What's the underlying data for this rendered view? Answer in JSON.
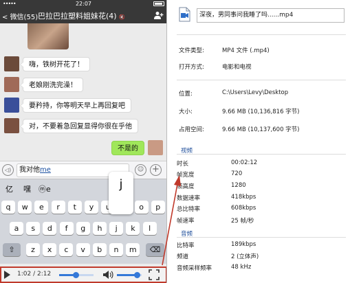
{
  "status_bar": {
    "signal": "•••••",
    "time": "22:07"
  },
  "nav": {
    "back_label": "微信(55)",
    "chat_title": "巴拉巴拉塑料姐妹花(4)",
    "mute_symbol": "🔇"
  },
  "messages": [
    {
      "text": "嗨，铁树开花了！",
      "avatar_color": "#6b4a3a"
    },
    {
      "text": "老娘刚洗完澡！",
      "avatar_color": "#a06a58"
    },
    {
      "text": "要矜持，你等明天早上再回复吧",
      "avatar_color": "#3a4f9a"
    },
    {
      "text": "对，不要着急回复显得你很在乎他",
      "avatar_color": "#7a5040"
    }
  ],
  "my_message": {
    "text": "不是的",
    "avatar_color": "#c99a84"
  },
  "input": {
    "voice_symbol": "◁)",
    "typed_text": "我对他",
    "composing": "me",
    "emoji_symbol": "☺",
    "plus_symbol": "+"
  },
  "candidates": [
    "亿",
    "嘿",
    "ⓜe"
  ],
  "key_popup": "j",
  "keyboard": {
    "row1": [
      "q",
      "w",
      "e",
      "r",
      "t",
      "y",
      "u",
      "i",
      "o",
      "p"
    ],
    "row2": [
      "a",
      "s",
      "d",
      "f",
      "g",
      "h",
      "j",
      "k",
      "l"
    ],
    "row3": [
      "z",
      "x",
      "c",
      "v",
      "b",
      "n",
      "m"
    ],
    "shift_symbol": "⇧",
    "delete_symbol": "⌫"
  },
  "player": {
    "time": "1:02 / 2:12",
    "progress": 0.47,
    "volume": 0.8
  },
  "properties": {
    "filename": "深夜，男同事问我睡了吗......mp4",
    "general": [
      {
        "label": "文件类型:",
        "value": "MP4 文件 (.mp4)"
      },
      {
        "label": "打开方式:",
        "value": "电影和电视"
      }
    ],
    "location": [
      {
        "label": "位置:",
        "value": "C:\\Users\\Levy\\Desktop"
      },
      {
        "label": "大小:",
        "value": "9.66 MB (10,136,816 字节)"
      },
      {
        "label": "占用空间:",
        "value": "9.66 MB (10,137,600 字节)"
      }
    ],
    "video_section": "视频",
    "video": [
      {
        "label": "时长",
        "value": "00:02:12"
      },
      {
        "label": "帧宽度",
        "value": "720"
      },
      {
        "label": "帧高度",
        "value": "1280"
      },
      {
        "label": "数据速率",
        "value": "418kbps"
      },
      {
        "label": "总比特率",
        "value": "608kbps"
      },
      {
        "label": "帧速率",
        "value": "25 帧/秒"
      }
    ],
    "audio_section": "音频",
    "audio": [
      {
        "label": "比特率",
        "value": "189kbps"
      },
      {
        "label": "频道",
        "value": "2 (立体声)"
      },
      {
        "label": "音频采样频率",
        "value": "48 kHz"
      }
    ]
  },
  "colors": {
    "annotation": "#c0392b",
    "section_title": "#1f4e9a",
    "my_bubble": "#a0e75a"
  }
}
